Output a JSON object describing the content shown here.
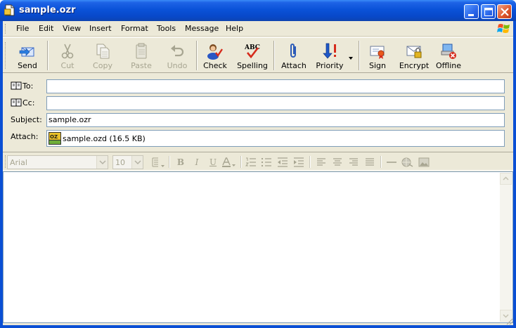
{
  "window": {
    "title": "sample.ozr"
  },
  "menu": [
    "File",
    "Edit",
    "View",
    "Insert",
    "Format",
    "Tools",
    "Message",
    "Help"
  ],
  "toolbar": {
    "send": "Send",
    "cut": "Cut",
    "copy": "Copy",
    "paste": "Paste",
    "undo": "Undo",
    "check": "Check",
    "spelling": "Spelling",
    "attach": "Attach",
    "priority": "Priority",
    "sign": "Sign",
    "encrypt": "Encrypt",
    "offline": "Offline"
  },
  "fields": {
    "to_label": "To:",
    "to_value": "",
    "cc_label": "Cc:",
    "cc_value": "",
    "subject_label": "Subject:",
    "subject_value": "sample.ozr",
    "attach_label": "Attach:",
    "attachment": "sample.ozd (16.5 KB)"
  },
  "format": {
    "font": "Arial",
    "size": "10"
  },
  "icons": {
    "title": "document-icon",
    "logo": "windows-flag-icon"
  }
}
